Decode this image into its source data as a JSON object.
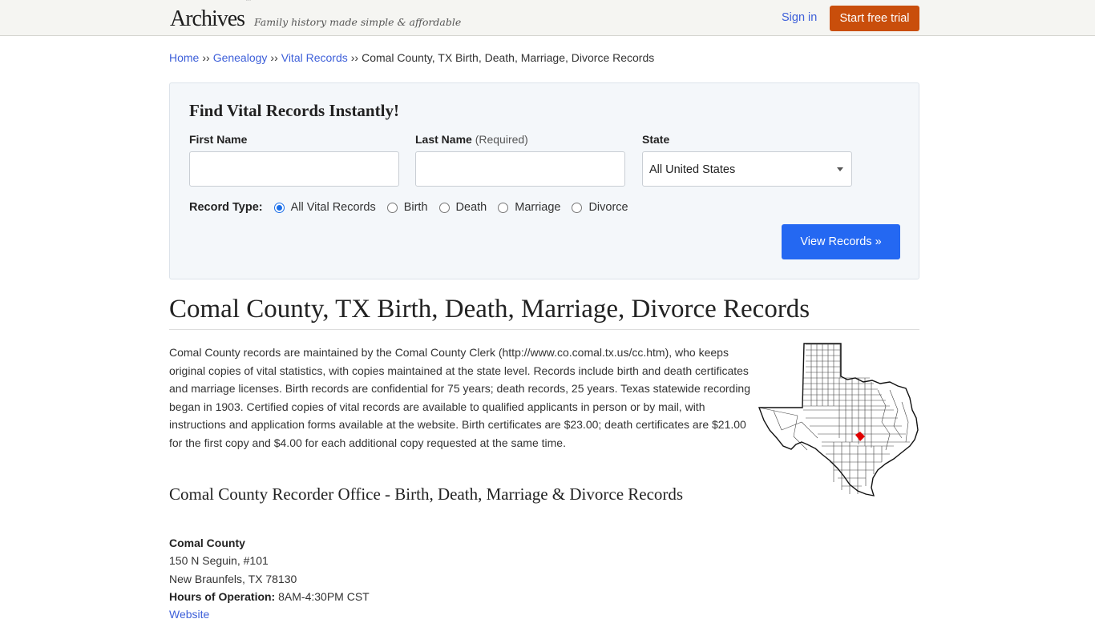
{
  "header": {
    "logo": "Archives",
    "logo_tm": "™",
    "tagline": "Family history made simple & affordable",
    "signin_label": "Sign in",
    "trial_label": "Start free trial",
    "trial_color": "#c94e0b"
  },
  "breadcrumb": {
    "items": [
      "Home",
      "Genealogy",
      "Vital Records"
    ],
    "current": "Comal County, TX Birth, Death, Marriage, Divorce Records",
    "separator": "››"
  },
  "search": {
    "title": "Find Vital Records Instantly!",
    "first_name_label": "First Name",
    "first_name_value": "",
    "last_name_label": "Last Name",
    "last_name_required": "(Required)",
    "last_name_value": "",
    "state_label": "State",
    "state_value": "All United States",
    "record_type_label": "Record Type:",
    "record_types": [
      {
        "label": "All Vital Records",
        "checked": true
      },
      {
        "label": "Birth",
        "checked": false
      },
      {
        "label": "Death",
        "checked": false
      },
      {
        "label": "Marriage",
        "checked": false
      },
      {
        "label": "Divorce",
        "checked": false
      }
    ],
    "submit_label": "View Records »",
    "submit_color": "#2468f2"
  },
  "main": {
    "title": "Comal County, TX Birth, Death, Marriage, Divorce Records",
    "intro": "Comal County records are maintained by the Comal County Clerk (http://www.co.comal.tx.us/cc.htm), who keeps original copies of vital statistics, with copies maintained at the state level. Records include birth and death certificates and marriage licenses. Birth records are confidential for 75 years; death records, 25 years. Texas statewide recording began in 1903. Certified copies of vital records are available to qualified applicants in person or by mail, with instructions and application forms available at the website. Birth certificates are $23.00; death certificates are $21.00 for the first copy and $4.00 for each additional copy requested at the same time.",
    "map_alt": "Texas county map with Comal County highlighted",
    "highlight_color": "#e00000",
    "office_heading": "Comal County Recorder Office - Birth, Death, Marriage & Divorce Records",
    "office": {
      "name": "Comal County",
      "address1": "150 N Seguin, #101",
      "address2": "New Braunfels, TX 78130",
      "hours_label": "Hours of Operation:",
      "hours_value": "8AM-4:30PM CST",
      "website_label": "Website"
    }
  }
}
